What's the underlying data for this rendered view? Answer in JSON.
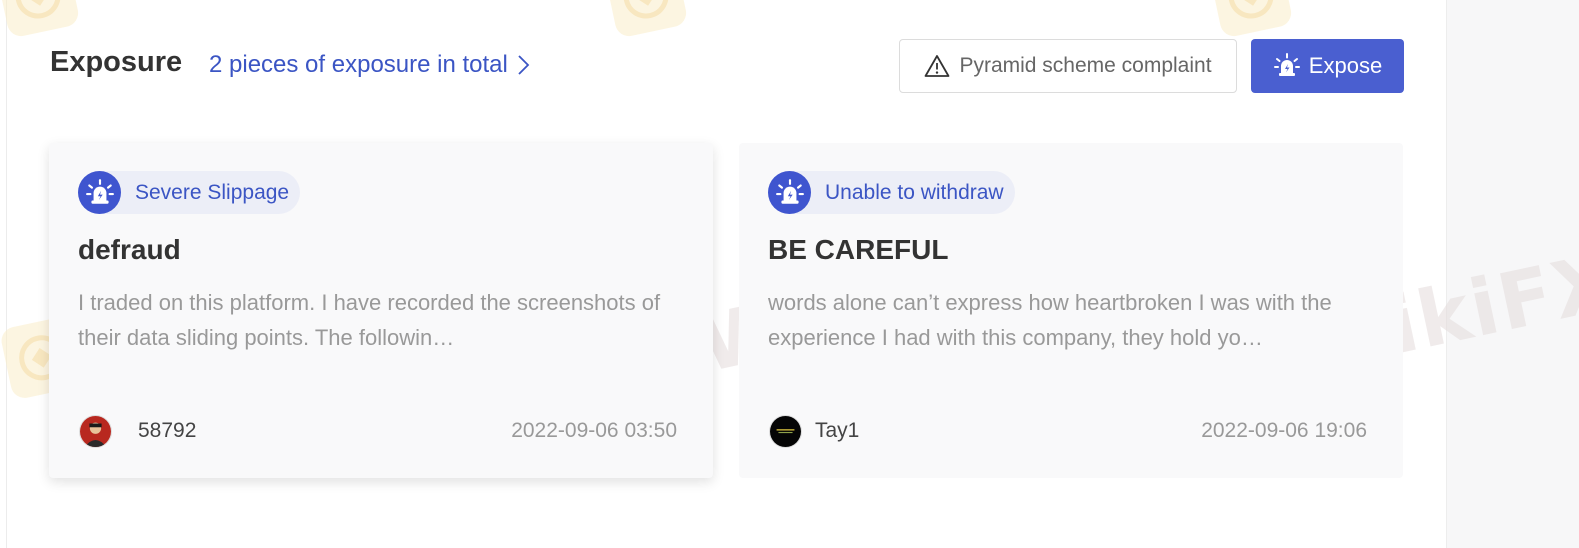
{
  "header": {
    "title": "Exposure",
    "count_link": "2 pieces of exposure in total",
    "complaint_button": "Pyramid scheme complaint",
    "expose_button": "Expose"
  },
  "watermark": {
    "text": "WikiFX"
  },
  "cards": [
    {
      "tag": "Severe Slippage",
      "title": "defraud",
      "body": "I traded on this platform. I have recorded the screenshots of their data sliding points. The followin…",
      "username": "58792",
      "timestamp": "2022-09-06 03:50",
      "avatar_icon": "user-avatar-red"
    },
    {
      "tag": "Unable to withdraw",
      "title": "BE CAREFUL",
      "body": "words alone can’t express how heartbroken I was with the experience I had with this company, they hold yo…",
      "username": "Tay1",
      "timestamp": "2022-09-06 19:06",
      "avatar_icon": "user-avatar-black"
    }
  ],
  "colors": {
    "accent": "#3b55c4",
    "button_primary": "#4a5fd0",
    "tag_background": "#eceef7",
    "card_background": "#f9f9fa"
  }
}
